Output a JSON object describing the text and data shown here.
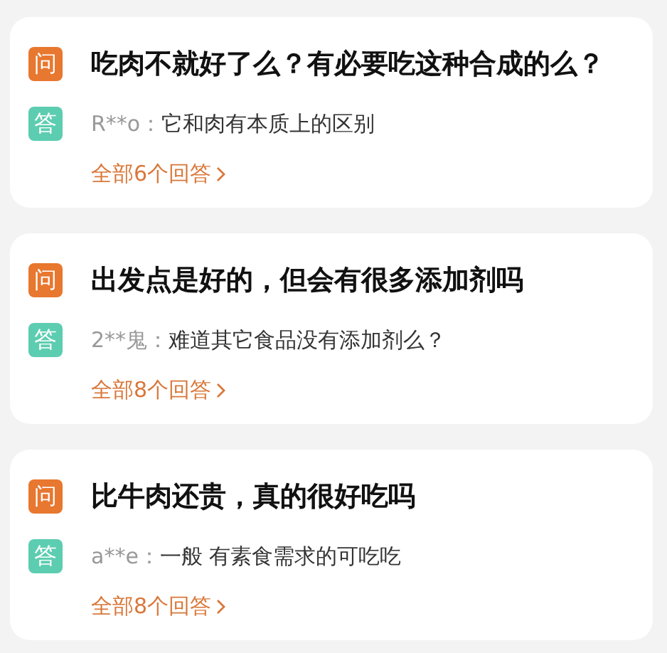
{
  "questions": [
    {
      "question_badge": "问",
      "question": "吃肉不就好了么？有必要吃这种合成的么？",
      "answer_badge": "答",
      "answerer": "R**o：",
      "answer": "它和肉有本质上的区别",
      "all_answers_link": "全部6个回答"
    },
    {
      "question_badge": "问",
      "question": "出发点是好的，但会有很多添加剂吗",
      "answer_badge": "答",
      "answerer": "2**鬼：",
      "answer": "难道其它食品没有添加剂么？",
      "all_answers_link": "全部8个回答"
    },
    {
      "question_badge": "问",
      "question": "比牛肉还贵，真的很好吃吗",
      "answer_badge": "答",
      "answerer": "a**e：",
      "answer": "一般 有素食需求的可吃吃",
      "all_answers_link": "全部8个回答"
    }
  ]
}
